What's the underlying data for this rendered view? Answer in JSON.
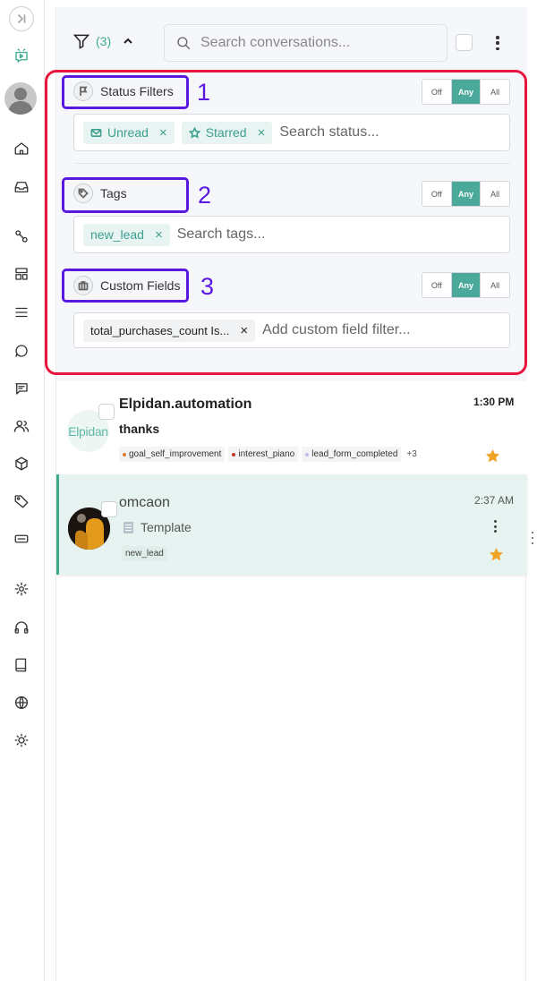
{
  "sidebar": {
    "items": [
      {
        "icon": "collapse-icon"
      },
      {
        "icon": "chat-brand-icon"
      },
      {
        "icon": "user-avatar-icon"
      },
      {
        "icon": "home-icon"
      },
      {
        "icon": "inbox-icon"
      },
      {
        "icon": "flow-icon"
      },
      {
        "icon": "layout-icon"
      },
      {
        "icon": "menu-list-icon"
      },
      {
        "icon": "chat-bubble-icon"
      },
      {
        "icon": "message-square-icon"
      },
      {
        "icon": "contacts-icon"
      },
      {
        "icon": "box-icon"
      },
      {
        "icon": "tag-icon"
      },
      {
        "icon": "keyboard-icon"
      },
      {
        "icon": "settings-icon"
      },
      {
        "icon": "headphones-icon"
      },
      {
        "icon": "book-icon"
      },
      {
        "icon": "globe-icon"
      },
      {
        "icon": "sun-icon"
      }
    ]
  },
  "toolbar": {
    "filter_count": "(3)",
    "search_placeholder": "Search conversations..."
  },
  "filters": {
    "status": {
      "label": "Status Filters",
      "mode_options": [
        "Off",
        "Any",
        "All"
      ],
      "selected_mode": "Any",
      "chips": [
        "Unread",
        "Starred"
      ],
      "search_placeholder": "Search status..."
    },
    "tags": {
      "label": "Tags",
      "mode_options": [
        "Off",
        "Any",
        "All"
      ],
      "selected_mode": "Any",
      "chips": [
        "new_lead"
      ],
      "search_placeholder": "Search tags..."
    },
    "custom_fields": {
      "label": "Custom Fields",
      "mode_options": [
        "Off",
        "Any",
        "All"
      ],
      "selected_mode": "Any",
      "chips": [
        "total_purchases_count Is..."
      ],
      "search_placeholder": "Add custom field filter..."
    }
  },
  "annotations": {
    "labels": [
      "1",
      "2",
      "3"
    ],
    "frame_color": "#e8153e",
    "box_color": "#5a19e0"
  },
  "conversations": [
    {
      "name": "Elpidan.automation",
      "avatar_text": "Elpidan",
      "time": "1:30 PM",
      "message": "thanks",
      "tags": [
        {
          "label": "goal_self_improvement",
          "color": "#e07b2a"
        },
        {
          "label": "interest_piano",
          "color": "#c0392b"
        },
        {
          "label": "lead_form_completed",
          "color": "#c9b8f0"
        }
      ],
      "more_tags": "+3",
      "starred": true
    },
    {
      "name": "omcaon",
      "time": "2:37 AM",
      "message": "Template",
      "tags": [
        {
          "label": "new_lead"
        }
      ],
      "starred": true,
      "selected": true
    }
  ],
  "colors": {
    "accent": "#3aaa8c",
    "toggle_active": "#4aa99a",
    "star": "#f0a324"
  }
}
